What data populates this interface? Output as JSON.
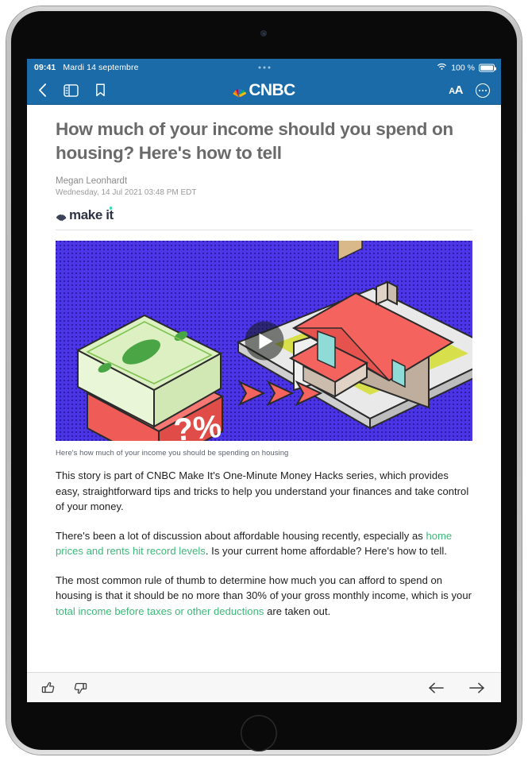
{
  "device": {
    "type": "tablet",
    "bezel_color": "#0a0a0a"
  },
  "status_bar": {
    "time": "09:41",
    "date": "Mardi 14 septembre",
    "wifi_icon": "wifi-icon",
    "battery_text": "100 %",
    "battery_icon": "battery-full-icon",
    "multitask_indicator": "multitask-dots-indicator",
    "background": "#1a6ba8"
  },
  "toolbar": {
    "back_icon": "chevron-left-icon",
    "sidebar_icon": "sidebar-toggle-icon",
    "bookmark_icon": "bookmark-icon",
    "brand": "CNBC",
    "brand_logo_icon": "nbc-peacock-icon",
    "text_size_small": "A",
    "text_size_large": "A",
    "more_icon": "more-circle-icon"
  },
  "article": {
    "headline": "How much of your income should you spend on housing? Here's how to tell",
    "author": "Megan Leonhardt",
    "pubdate": "Wednesday, 14 Jul 2021 03:48 PM EDT",
    "section_logo_text": "make it",
    "section_logo_icon": "nbc-peacock-small-icon",
    "hero": {
      "alt": "Isometric illustration of a stack of cash above a red block marked ?% pointing toward a house",
      "play_icon": "play-button-icon",
      "question_label": "?%",
      "colors": {
        "background": "#4a34e6",
        "money_block": "#d8f0c0",
        "red_block": "#f4635e",
        "roof": "#f4635e",
        "lawn": "#d7e04a",
        "platform": "#f2f2f2"
      }
    },
    "caption": "Here's how much of your income you should be spending on housing",
    "paragraphs": [
      {
        "segments": [
          {
            "text": "This story is part of CNBC Make It's One-Minute Money Hacks series, which provides easy, straightforward tips and tricks to help you understand your finances and take control of your money.",
            "link": false
          }
        ]
      },
      {
        "segments": [
          {
            "text": "There's been a lot of discussion about affordable housing recently, especially as ",
            "link": false
          },
          {
            "text": "home prices and rents hit record levels",
            "link": true
          },
          {
            "text": ". Is your current home affordable? Here's how to tell.",
            "link": false
          }
        ]
      },
      {
        "segments": [
          {
            "text": "The most common rule of thumb to determine how much you can afford to spend on housing is that it should be no more than 30% of your gross monthly income, which is your ",
            "link": false
          },
          {
            "text": "total income before taxes or other deductions",
            "link": true
          },
          {
            "text": " are taken out.",
            "link": false
          }
        ]
      }
    ],
    "link_color": "#3cb878"
  },
  "bottom_bar": {
    "like_icon": "thumbs-up-icon",
    "dislike_icon": "thumbs-down-icon",
    "prev_icon": "arrow-left-icon",
    "next_icon": "arrow-right-icon"
  }
}
